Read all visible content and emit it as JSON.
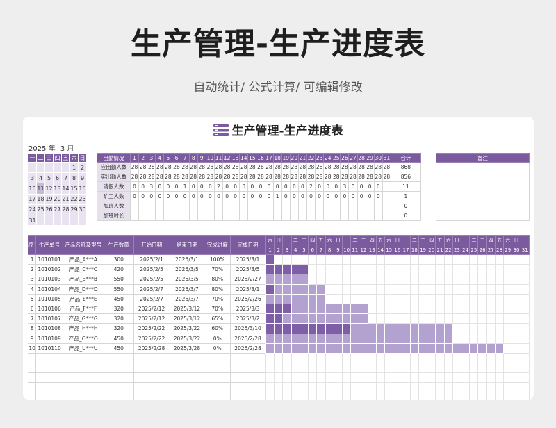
{
  "header": {
    "title": "生产管理-生产进度表",
    "subtitle": "自动统计/ 公式计算/ 可编辑修改"
  },
  "sheet": {
    "title": "生产管理-生产进度表",
    "year": "2025",
    "year_unit": "年",
    "month": "3",
    "month_unit": "月"
  },
  "calendar": {
    "weekdays": [
      "一",
      "二",
      "三",
      "四",
      "五",
      "六",
      "日"
    ],
    "rows": [
      [
        "",
        "",
        "",
        "",
        "",
        "1",
        "2"
      ],
      [
        "3",
        "4",
        "5",
        "6",
        "7",
        "8",
        "9"
      ],
      [
        "10",
        "11",
        "12",
        "13",
        "14",
        "15",
        "16"
      ],
      [
        "17",
        "18",
        "19",
        "20",
        "21",
        "22",
        "23"
      ],
      [
        "24",
        "25",
        "26",
        "27",
        "28",
        "29",
        "30"
      ],
      [
        "31",
        "",
        "",
        "",
        "",
        "",
        ""
      ]
    ],
    "highlight": "11"
  },
  "attendance": {
    "header_label": "出勤情况",
    "days": [
      "1",
      "2",
      "3",
      "4",
      "5",
      "6",
      "7",
      "8",
      "9",
      "10",
      "11",
      "12",
      "13",
      "14",
      "15",
      "16",
      "17",
      "18",
      "19",
      "20",
      "21",
      "22",
      "23",
      "24",
      "25",
      "26",
      "27",
      "28",
      "29",
      "30",
      "31"
    ],
    "total_label": "合计",
    "rows": [
      {
        "label": "应出勤人数",
        "values": [
          "28",
          "28",
          "28",
          "28",
          "28",
          "28",
          "28",
          "28",
          "28",
          "28",
          "28",
          "28",
          "28",
          "28",
          "28",
          "28",
          "28",
          "28",
          "28",
          "28",
          "28",
          "28",
          "28",
          "28",
          "28",
          "28",
          "28",
          "28",
          "28",
          "28",
          "28"
        ],
        "total": "868"
      },
      {
        "label": "实出勤人数",
        "values": [
          "28",
          "28",
          "28",
          "28",
          "28",
          "28",
          "28",
          "28",
          "28",
          "28",
          "28",
          "28",
          "28",
          "28",
          "28",
          "28",
          "28",
          "28",
          "28",
          "28",
          "28",
          "28",
          "28",
          "28",
          "28",
          "28",
          "28",
          "28",
          "28",
          "28",
          "28"
        ],
        "total": "856"
      },
      {
        "label": "请假人数",
        "values": [
          "0",
          "0",
          "3",
          "0",
          "0",
          "0",
          "1",
          "0",
          "0",
          "0",
          "2",
          "0",
          "0",
          "0",
          "0",
          "0",
          "0",
          "0",
          "0",
          "0",
          "0",
          "2",
          "0",
          "0",
          "0",
          "3",
          "0",
          "0",
          "0",
          "0",
          ""
        ],
        "total": "11"
      },
      {
        "label": "旷工人数",
        "values": [
          "0",
          "0",
          "0",
          "0",
          "0",
          "0",
          "0",
          "0",
          "0",
          "0",
          "0",
          "0",
          "0",
          "0",
          "0",
          "0",
          "0",
          "1",
          "0",
          "0",
          "0",
          "0",
          "0",
          "0",
          "0",
          "0",
          "0",
          "0",
          "0",
          "0",
          ""
        ],
        "total": "1"
      },
      {
        "label": "加班人数",
        "values": [
          "",
          "",
          "",
          "",
          "",
          "",
          "",
          "",
          "",
          "",
          "",
          "",
          "",
          "",
          "",
          "",
          "",
          "",
          "",
          "",
          "",
          "",
          "",
          "",
          "",
          "",
          "",
          "",
          "",
          "",
          ""
        ],
        "total": "0"
      },
      {
        "label": "加班时长",
        "values": [
          "",
          "",
          "",
          "",
          "",
          "",
          "",
          "",
          "",
          "",
          "",
          "",
          "",
          "",
          "",
          "",
          "",
          "",
          "",
          "",
          "",
          "",
          "",
          "",
          "",
          "",
          "",
          "",
          "",
          "",
          ""
        ],
        "total": "0"
      }
    ]
  },
  "notes": {
    "label": "备注"
  },
  "production": {
    "headers": [
      "序号",
      "生产单号",
      "产品名称及型号",
      "生产数量",
      "开始日期",
      "结束日期",
      "完成进度",
      "完成日期"
    ],
    "rows": [
      {
        "no": "1",
        "order": "1010101",
        "product": "产品_A***A",
        "qty": "300",
        "start": "2025/2/1",
        "end": "2025/3/1",
        "progress": "100%",
        "done": "2025/3/1",
        "bar_start": 1,
        "bar_len": 1,
        "bar_done": 1
      },
      {
        "no": "2",
        "order": "1010102",
        "product": "产品_C***C",
        "qty": "420",
        "start": "2025/2/5",
        "end": "2025/3/5",
        "progress": "70%",
        "done": "2025/3/5",
        "bar_start": 1,
        "bar_len": 5,
        "bar_done": 5
      },
      {
        "no": "3",
        "order": "1010103",
        "product": "产品_B***B",
        "qty": "550",
        "start": "2025/2/5",
        "end": "2025/3/5",
        "progress": "80%",
        "done": "2025/2/27",
        "bar_start": 1,
        "bar_len": 5,
        "bar_done": 0
      },
      {
        "no": "4",
        "order": "1010104",
        "product": "产品_D***D",
        "qty": "550",
        "start": "2025/2/7",
        "end": "2025/3/7",
        "progress": "80%",
        "done": "2025/3/1",
        "bar_start": 1,
        "bar_len": 7,
        "bar_done": 1
      },
      {
        "no": "5",
        "order": "1010105",
        "product": "产品_E***E",
        "qty": "450",
        "start": "2025/2/7",
        "end": "2025/3/7",
        "progress": "70%",
        "done": "2025/2/26",
        "bar_start": 1,
        "bar_len": 7,
        "bar_done": 0
      },
      {
        "no": "6",
        "order": "1010106",
        "product": "产品_F***F",
        "qty": "320",
        "start": "2025/2/12",
        "end": "2025/3/12",
        "progress": "70%",
        "done": "2025/3/3",
        "bar_start": 1,
        "bar_len": 12,
        "bar_done": 3
      },
      {
        "no": "7",
        "order": "1010107",
        "product": "产品_G***G",
        "qty": "320",
        "start": "2025/2/12",
        "end": "2025/3/12",
        "progress": "65%",
        "done": "2025/3/2",
        "bar_start": 1,
        "bar_len": 12,
        "bar_done": 2
      },
      {
        "no": "8",
        "order": "1010108",
        "product": "产品_H***H",
        "qty": "320",
        "start": "2025/2/22",
        "end": "2025/3/22",
        "progress": "60%",
        "done": "2025/3/10",
        "bar_start": 1,
        "bar_len": 22,
        "bar_done": 10
      },
      {
        "no": "9",
        "order": "1010109",
        "product": "产品_O***O",
        "qty": "450",
        "start": "2025/2/22",
        "end": "2025/3/22",
        "progress": "0%",
        "done": "2025/2/28",
        "bar_start": 1,
        "bar_len": 22,
        "bar_done": 0
      },
      {
        "no": "10",
        "order": "1010110",
        "product": "产品_U***U",
        "qty": "450",
        "start": "2025/2/28",
        "end": "2025/3/28",
        "progress": "0%",
        "done": "2025/2/28",
        "bar_start": 1,
        "bar_len": 28,
        "bar_done": 0
      }
    ],
    "empty_rows": 5
  },
  "gantt": {
    "weekdays": [
      "六",
      "日",
      "一",
      "二",
      "三",
      "四",
      "五",
      "六",
      "日",
      "一",
      "二",
      "三",
      "四",
      "五",
      "六",
      "日",
      "一",
      "二",
      "三",
      "四",
      "五",
      "六",
      "日",
      "一",
      "二",
      "三",
      "四",
      "五",
      "六",
      "日",
      "一"
    ],
    "days": [
      "1",
      "2",
      "3",
      "4",
      "5",
      "6",
      "7",
      "8",
      "9",
      "10",
      "11",
      "12",
      "13",
      "14",
      "15",
      "16",
      "17",
      "18",
      "19",
      "20",
      "21",
      "22",
      "23",
      "24",
      "25",
      "26",
      "27",
      "28",
      "29",
      "30",
      "31"
    ]
  },
  "colors": {
    "header": "#7b5a9e",
    "bar": "#b3a1cf",
    "bar_done": "#7e5ea7",
    "calendar_bg": "#e9e3f1"
  }
}
